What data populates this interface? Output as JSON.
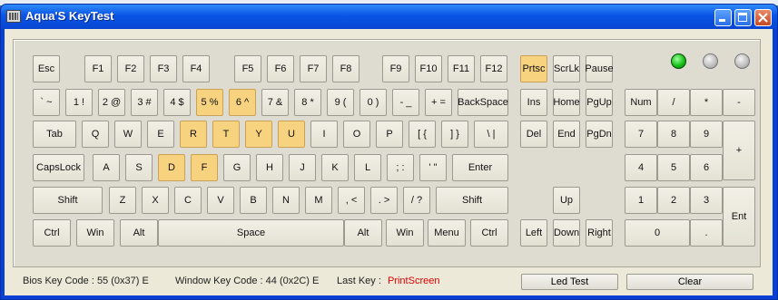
{
  "window": {
    "title": "Aqua'S KeyTest"
  },
  "colors": {
    "highlight": "#f7d27f",
    "led_on": "#17c017",
    "last_key": "#e00000"
  },
  "keys": [
    {
      "id": "esc",
      "label": "Esc",
      "hl": false
    },
    {
      "id": "f1",
      "label": "F1",
      "hl": false
    },
    {
      "id": "f2",
      "label": "F2",
      "hl": false
    },
    {
      "id": "f3",
      "label": "F3",
      "hl": false
    },
    {
      "id": "f4",
      "label": "F4",
      "hl": false
    },
    {
      "id": "f5",
      "label": "F5",
      "hl": false
    },
    {
      "id": "f6",
      "label": "F6",
      "hl": false
    },
    {
      "id": "f7",
      "label": "F7",
      "hl": false
    },
    {
      "id": "f8",
      "label": "F8",
      "hl": false
    },
    {
      "id": "f9",
      "label": "F9",
      "hl": false
    },
    {
      "id": "f10",
      "label": "F10",
      "hl": false
    },
    {
      "id": "f11",
      "label": "F11",
      "hl": false
    },
    {
      "id": "f12",
      "label": "F12",
      "hl": false
    },
    {
      "id": "prtsc",
      "label": "Prtsc",
      "hl": true
    },
    {
      "id": "scrlk",
      "label": "ScrLk",
      "hl": false
    },
    {
      "id": "pause",
      "label": "Pause",
      "hl": false
    },
    {
      "id": "backtick",
      "label": "` ~",
      "hl": false
    },
    {
      "id": "1",
      "label": "1 !",
      "hl": false
    },
    {
      "id": "2",
      "label": "2 @",
      "hl": false
    },
    {
      "id": "3",
      "label": "3 #",
      "hl": false
    },
    {
      "id": "4",
      "label": "4 $",
      "hl": false
    },
    {
      "id": "5",
      "label": "5 %",
      "hl": true
    },
    {
      "id": "6",
      "label": "6 ^",
      "hl": true
    },
    {
      "id": "7",
      "label": "7 &",
      "hl": false
    },
    {
      "id": "8",
      "label": "8 *",
      "hl": false
    },
    {
      "id": "9",
      "label": "9 (",
      "hl": false
    },
    {
      "id": "0",
      "label": "0 )",
      "hl": false
    },
    {
      "id": "minus",
      "label": "- _",
      "hl": false
    },
    {
      "id": "equals",
      "label": "+ =",
      "hl": false
    },
    {
      "id": "backspace",
      "label": "BackSpace",
      "hl": false
    },
    {
      "id": "ins",
      "label": "Ins",
      "hl": false
    },
    {
      "id": "home",
      "label": "Home",
      "hl": false
    },
    {
      "id": "pgup",
      "label": "PgUp",
      "hl": false
    },
    {
      "id": "num",
      "label": "Num",
      "hl": false
    },
    {
      "id": "kp-div",
      "label": "/",
      "hl": false
    },
    {
      "id": "kp-mul",
      "label": "*",
      "hl": false
    },
    {
      "id": "kp-minus",
      "label": "-",
      "hl": false
    },
    {
      "id": "tab",
      "label": "Tab",
      "hl": false
    },
    {
      "id": "q",
      "label": "Q",
      "hl": false
    },
    {
      "id": "w",
      "label": "W",
      "hl": false
    },
    {
      "id": "e",
      "label": "E",
      "hl": false
    },
    {
      "id": "r",
      "label": "R",
      "hl": true
    },
    {
      "id": "t",
      "label": "T",
      "hl": true
    },
    {
      "id": "y",
      "label": "Y",
      "hl": true
    },
    {
      "id": "u",
      "label": "U",
      "hl": true
    },
    {
      "id": "i",
      "label": "I",
      "hl": false
    },
    {
      "id": "o",
      "label": "O",
      "hl": false
    },
    {
      "id": "p",
      "label": "P",
      "hl": false
    },
    {
      "id": "lbracket",
      "label": "[ {",
      "hl": false
    },
    {
      "id": "rbracket",
      "label": "] }",
      "hl": false
    },
    {
      "id": "backslash",
      "label": "\\ |",
      "hl": false
    },
    {
      "id": "del",
      "label": "Del",
      "hl": false
    },
    {
      "id": "end",
      "label": "End",
      "hl": false
    },
    {
      "id": "pgdn",
      "label": "PgDn",
      "hl": false
    },
    {
      "id": "kp7",
      "label": "7",
      "hl": false
    },
    {
      "id": "kp8",
      "label": "8",
      "hl": false
    },
    {
      "id": "kp9",
      "label": "9",
      "hl": false
    },
    {
      "id": "kp-plus",
      "label": "+",
      "hl": false
    },
    {
      "id": "capslock",
      "label": "CapsLock",
      "hl": false
    },
    {
      "id": "a",
      "label": "A",
      "hl": false
    },
    {
      "id": "s",
      "label": "S",
      "hl": false
    },
    {
      "id": "d",
      "label": "D",
      "hl": true
    },
    {
      "id": "f",
      "label": "F",
      "hl": true
    },
    {
      "id": "g",
      "label": "G",
      "hl": false
    },
    {
      "id": "h",
      "label": "H",
      "hl": false
    },
    {
      "id": "j",
      "label": "J",
      "hl": false
    },
    {
      "id": "k",
      "label": "K",
      "hl": false
    },
    {
      "id": "l",
      "label": "L",
      "hl": false
    },
    {
      "id": "semicolon",
      "label": "; :",
      "hl": false
    },
    {
      "id": "quote",
      "label": "' \"",
      "hl": false
    },
    {
      "id": "enter",
      "label": "Enter",
      "hl": false
    },
    {
      "id": "kp4",
      "label": "4",
      "hl": false
    },
    {
      "id": "kp5",
      "label": "5",
      "hl": false
    },
    {
      "id": "kp6",
      "label": "6",
      "hl": false
    },
    {
      "id": "lshift",
      "label": "Shift",
      "hl": false
    },
    {
      "id": "z",
      "label": "Z",
      "hl": false
    },
    {
      "id": "x",
      "label": "X",
      "hl": false
    },
    {
      "id": "c",
      "label": "C",
      "hl": false
    },
    {
      "id": "v",
      "label": "V",
      "hl": false
    },
    {
      "id": "b",
      "label": "B",
      "hl": false
    },
    {
      "id": "n",
      "label": "N",
      "hl": false
    },
    {
      "id": "m",
      "label": "M",
      "hl": false
    },
    {
      "id": "comma",
      "label": ", <",
      "hl": false
    },
    {
      "id": "period",
      "label": ". >",
      "hl": false
    },
    {
      "id": "slash",
      "label": "/ ?",
      "hl": false
    },
    {
      "id": "rshift",
      "label": "Shift",
      "hl": false
    },
    {
      "id": "up",
      "label": "Up",
      "hl": false
    },
    {
      "id": "kp1",
      "label": "1",
      "hl": false
    },
    {
      "id": "kp2",
      "label": "2",
      "hl": false
    },
    {
      "id": "kp3",
      "label": "3",
      "hl": false
    },
    {
      "id": "kp-enter",
      "label": "Ent",
      "hl": false
    },
    {
      "id": "lctrl",
      "label": "Ctrl",
      "hl": false
    },
    {
      "id": "lwin",
      "label": "Win",
      "hl": false
    },
    {
      "id": "lalt",
      "label": "Alt",
      "hl": false
    },
    {
      "id": "space",
      "label": "Space",
      "hl": false
    },
    {
      "id": "ralt",
      "label": "Alt",
      "hl": false
    },
    {
      "id": "rwin",
      "label": "Win",
      "hl": false
    },
    {
      "id": "menu",
      "label": "Menu",
      "hl": false
    },
    {
      "id": "rctrl",
      "label": "Ctrl",
      "hl": false
    },
    {
      "id": "left",
      "label": "Left",
      "hl": false
    },
    {
      "id": "down",
      "label": "Down",
      "hl": false
    },
    {
      "id": "right",
      "label": "Right",
      "hl": false
    },
    {
      "id": "kp0",
      "label": "0",
      "hl": false
    },
    {
      "id": "kp-dot",
      "label": ".",
      "hl": false
    }
  ],
  "leds": [
    {
      "name": "num-lock-led",
      "on": true
    },
    {
      "name": "caps-lock-led",
      "on": false
    },
    {
      "name": "scroll-lock-led",
      "on": false
    }
  ],
  "status": {
    "bios_label": "Bios Key Code :",
    "bios_value": "55 (0x37) E",
    "window_label": "Window Key Code :",
    "window_value": "44 (0x2C) E",
    "last_key_label": "Last Key :",
    "last_key_value": "PrintScreen",
    "led_test_button": "Led Test",
    "clear_button": "Clear"
  }
}
